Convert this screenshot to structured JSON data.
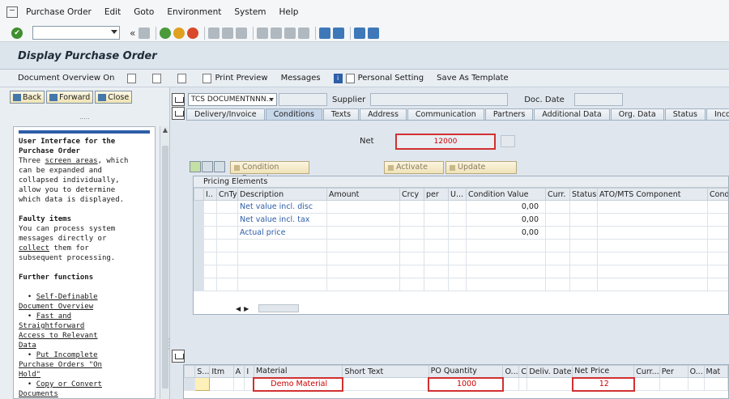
{
  "menu": [
    "Purchase Order",
    "Edit",
    "Goto",
    "Environment",
    "System",
    "Help"
  ],
  "toolbar": {
    "back_chevron": "«"
  },
  "title": "Display Purchase Order",
  "app_toolbar": {
    "doc_overview": "Document Overview On",
    "print_preview": "Print Preview",
    "messages": "Messages",
    "personal_setting": "Personal Setting",
    "save_template": "Save As Template"
  },
  "nav": {
    "back": "Back",
    "forward": "Forward",
    "close": "Close",
    "dots": "....."
  },
  "help": {
    "heading1": "User Interface for the\nPurchase Order",
    "p1a": "Three ",
    "p1_link": "screen areas",
    "p1b": ", which\ncan be expanded and\ncollapsed individually,\nallow you to determine\nwhich data is displayed.",
    "heading2": "Faulty items",
    "p2a": "You can process system\nmessages directly or\n",
    "p2_link": "collect",
    "p2b": " them for\nsubsequent processing.",
    "heading3": "Further functions",
    "bullets": [
      "Self-Definable\nDocument Overview",
      "Fast and\nStraightforward\nAccess to Relevant\nData",
      "Put Incomplete\nPurchase Orders \"On\nHold\"",
      "Copy or Convert\nDocuments"
    ]
  },
  "header": {
    "doc_type": "TCS DOCUMENTNNN...",
    "supplier_label": "Supplier",
    "docdate_label": "Doc. Date"
  },
  "tabs": [
    "Delivery/Invoice",
    "Conditions",
    "Texts",
    "Address",
    "Communication",
    "Partners",
    "Additional Data",
    "Org. Data",
    "Status",
    "Incoterms"
  ],
  "conditions": {
    "net_label": "Net",
    "net_value": "12000",
    "condition_record": "Condition Record",
    "activate": "Activate",
    "update": "Update",
    "pricing_title": "Pricing Elements",
    "columns": [
      "I..",
      "CnTy",
      "Description",
      "Amount",
      "Crcy",
      "per",
      "U...",
      "Condition Value",
      "Curr.",
      "Status",
      "ATO/MTS Component",
      "Cond"
    ],
    "rows": [
      {
        "description": "Net value incl. disc",
        "value": "0,00"
      },
      {
        "description": "Net value incl. tax",
        "value": "0,00"
      },
      {
        "description": "Actual price",
        "value": "0,00"
      }
    ]
  },
  "items": {
    "columns": [
      "S...",
      "Itm",
      "A",
      "I",
      "Material",
      "Short Text",
      "PO Quantity",
      "O...",
      "C",
      "Deliv. Date",
      "Net Price",
      "Curr...",
      "Per",
      "O...",
      "Mat"
    ],
    "row": {
      "material": "Demo Material",
      "quantity": "1000",
      "net_price": "12"
    }
  }
}
